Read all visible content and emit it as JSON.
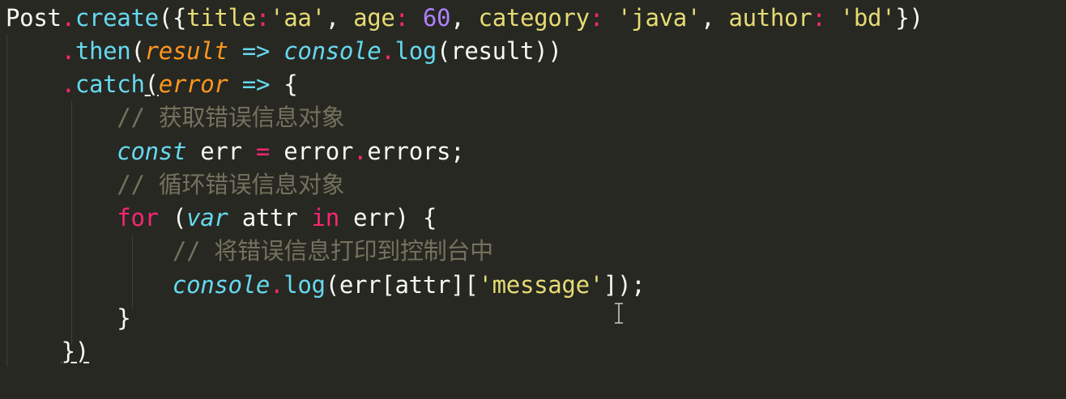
{
  "editor": {
    "theme_colors": {
      "background": "#272822",
      "text": "#f8f8f2",
      "keyword": "#f92672",
      "function": "#66d9ef",
      "string": "#e6db74",
      "number": "#ae81ff",
      "parameter": "#fd971f",
      "comment": "#75715e"
    },
    "lines": [
      {
        "tokens": [
          {
            "t": "Post",
            "c": "plain"
          },
          {
            "t": ".",
            "c": "pink"
          },
          {
            "t": "create",
            "c": "fn"
          },
          {
            "t": "({",
            "c": "plain"
          },
          {
            "t": "title",
            "c": "str"
          },
          {
            "t": ":",
            "c": "pink"
          },
          {
            "t": "'aa'",
            "c": "str"
          },
          {
            "t": ", ",
            "c": "plain"
          },
          {
            "t": "age",
            "c": "str"
          },
          {
            "t": ": ",
            "c": "pink"
          },
          {
            "t": "60",
            "c": "num"
          },
          {
            "t": ", ",
            "c": "plain"
          },
          {
            "t": "category",
            "c": "str"
          },
          {
            "t": ": ",
            "c": "pink"
          },
          {
            "t": "'java'",
            "c": "str"
          },
          {
            "t": ", ",
            "c": "plain"
          },
          {
            "t": "author",
            "c": "str"
          },
          {
            "t": ": ",
            "c": "pink"
          },
          {
            "t": "'bd'",
            "c": "str"
          },
          {
            "t": "})",
            "c": "plain"
          }
        ]
      },
      {
        "tokens": [
          {
            "t": "    ",
            "c": "plain"
          },
          {
            "t": ".",
            "c": "pink"
          },
          {
            "t": "then",
            "c": "fn"
          },
          {
            "t": "(",
            "c": "plain"
          },
          {
            "t": "result",
            "c": "param"
          },
          {
            "t": " ",
            "c": "plain"
          },
          {
            "t": "=>",
            "c": "storage"
          },
          {
            "t": " ",
            "c": "plain"
          },
          {
            "t": "console",
            "c": "support"
          },
          {
            "t": ".",
            "c": "pink"
          },
          {
            "t": "log",
            "c": "fn"
          },
          {
            "t": "(result))",
            "c": "plain"
          }
        ]
      },
      {
        "tokens": [
          {
            "t": "    ",
            "c": "plain"
          },
          {
            "t": ".",
            "c": "pink"
          },
          {
            "t": "catch",
            "c": "fn"
          },
          {
            "t": "(",
            "c": "plain ul"
          },
          {
            "t": "error",
            "c": "param"
          },
          {
            "t": " ",
            "c": "plain"
          },
          {
            "t": "=>",
            "c": "storage"
          },
          {
            "t": " {",
            "c": "plain"
          }
        ]
      },
      {
        "tokens": [
          {
            "t": "        ",
            "c": "plain"
          },
          {
            "t": "// 获取错误信息对象",
            "c": "comment"
          }
        ]
      },
      {
        "tokens": [
          {
            "t": "        ",
            "c": "plain"
          },
          {
            "t": "const",
            "c": "storage"
          },
          {
            "t": " err ",
            "c": "plain"
          },
          {
            "t": "=",
            "c": "kw"
          },
          {
            "t": " error",
            "c": "plain"
          },
          {
            "t": ".",
            "c": "pink"
          },
          {
            "t": "errors;",
            "c": "plain"
          }
        ]
      },
      {
        "tokens": [
          {
            "t": "        ",
            "c": "plain"
          },
          {
            "t": "// 循环错误信息对象",
            "c": "comment"
          }
        ]
      },
      {
        "tokens": [
          {
            "t": "        ",
            "c": "plain"
          },
          {
            "t": "for",
            "c": "kw"
          },
          {
            "t": " (",
            "c": "plain"
          },
          {
            "t": "var",
            "c": "storage"
          },
          {
            "t": " attr ",
            "c": "plain"
          },
          {
            "t": "in",
            "c": "kw"
          },
          {
            "t": " err) {",
            "c": "plain"
          }
        ]
      },
      {
        "tokens": [
          {
            "t": "            ",
            "c": "plain"
          },
          {
            "t": "// 将错误信息打印到控制台中",
            "c": "comment"
          }
        ]
      },
      {
        "tokens": [
          {
            "t": "            ",
            "c": "plain"
          },
          {
            "t": "console",
            "c": "support"
          },
          {
            "t": ".",
            "c": "pink"
          },
          {
            "t": "log",
            "c": "fn"
          },
          {
            "t": "(err[attr][",
            "c": "plain"
          },
          {
            "t": "'message'",
            "c": "str"
          },
          {
            "t": "]);",
            "c": "plain"
          }
        ]
      },
      {
        "tokens": [
          {
            "t": "        ",
            "c": "plain"
          },
          {
            "t": "}",
            "c": "plain"
          }
        ]
      },
      {
        "tokens": [
          {
            "t": "    ",
            "c": "plain"
          },
          {
            "t": "})",
            "c": "plain ul"
          }
        ]
      }
    ]
  }
}
